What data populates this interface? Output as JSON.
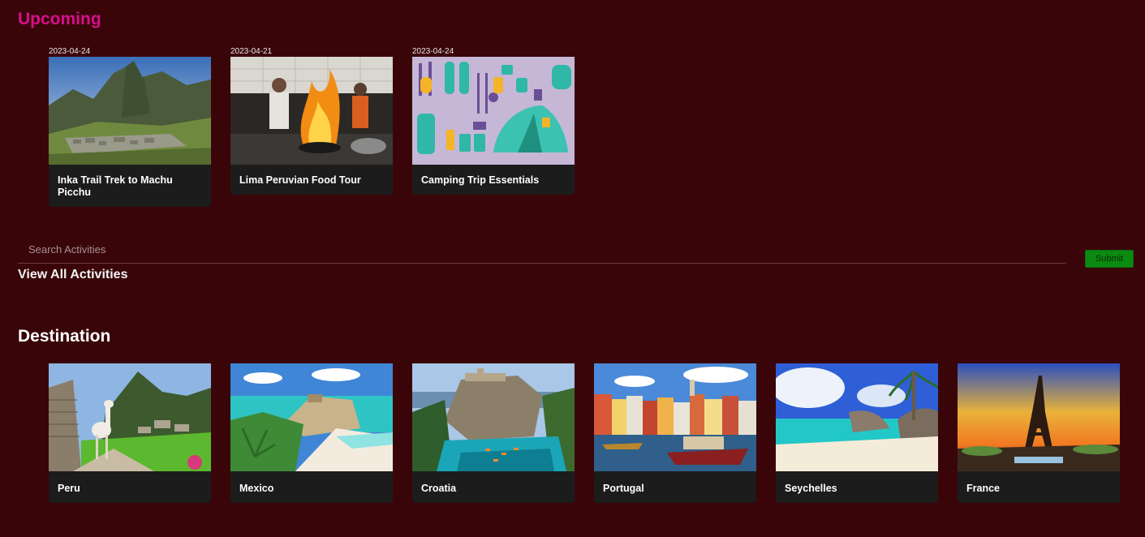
{
  "upcoming": {
    "title": "Upcoming",
    "items": [
      {
        "date": "2023-04-24",
        "title": "Inka Trail Trek to Machu Picchu",
        "image": "machu-picchu-mountain-photo"
      },
      {
        "date": "2023-04-21",
        "title": "Lima Peruvian Food Tour",
        "image": "chef-flambe-photo"
      },
      {
        "date": "2023-04-24",
        "title": "Camping Trip Essentials",
        "image": "camping-gear-illustration"
      }
    ]
  },
  "search": {
    "placeholder": "Search Activities",
    "submit_label": "Submit",
    "submit_color": "#0a8a10"
  },
  "view_all_label": "View All Activities",
  "destination": {
    "title": "Destination",
    "items": [
      {
        "name": "Peru",
        "image": "llama-machu-picchu-photo"
      },
      {
        "name": "Mexico",
        "image": "tulum-beach-photo"
      },
      {
        "name": "Croatia",
        "image": "dubrovnik-coast-photo"
      },
      {
        "name": "Portugal",
        "image": "porto-river-photo"
      },
      {
        "name": "Seychelles",
        "image": "seychelles-beach-photo"
      },
      {
        "name": "France",
        "image": "eiffel-tower-sunset-photo"
      }
    ]
  },
  "colors": {
    "background": "#3a0509",
    "upcoming_title": "#d6108c",
    "card_body": "#1c1c1c"
  }
}
